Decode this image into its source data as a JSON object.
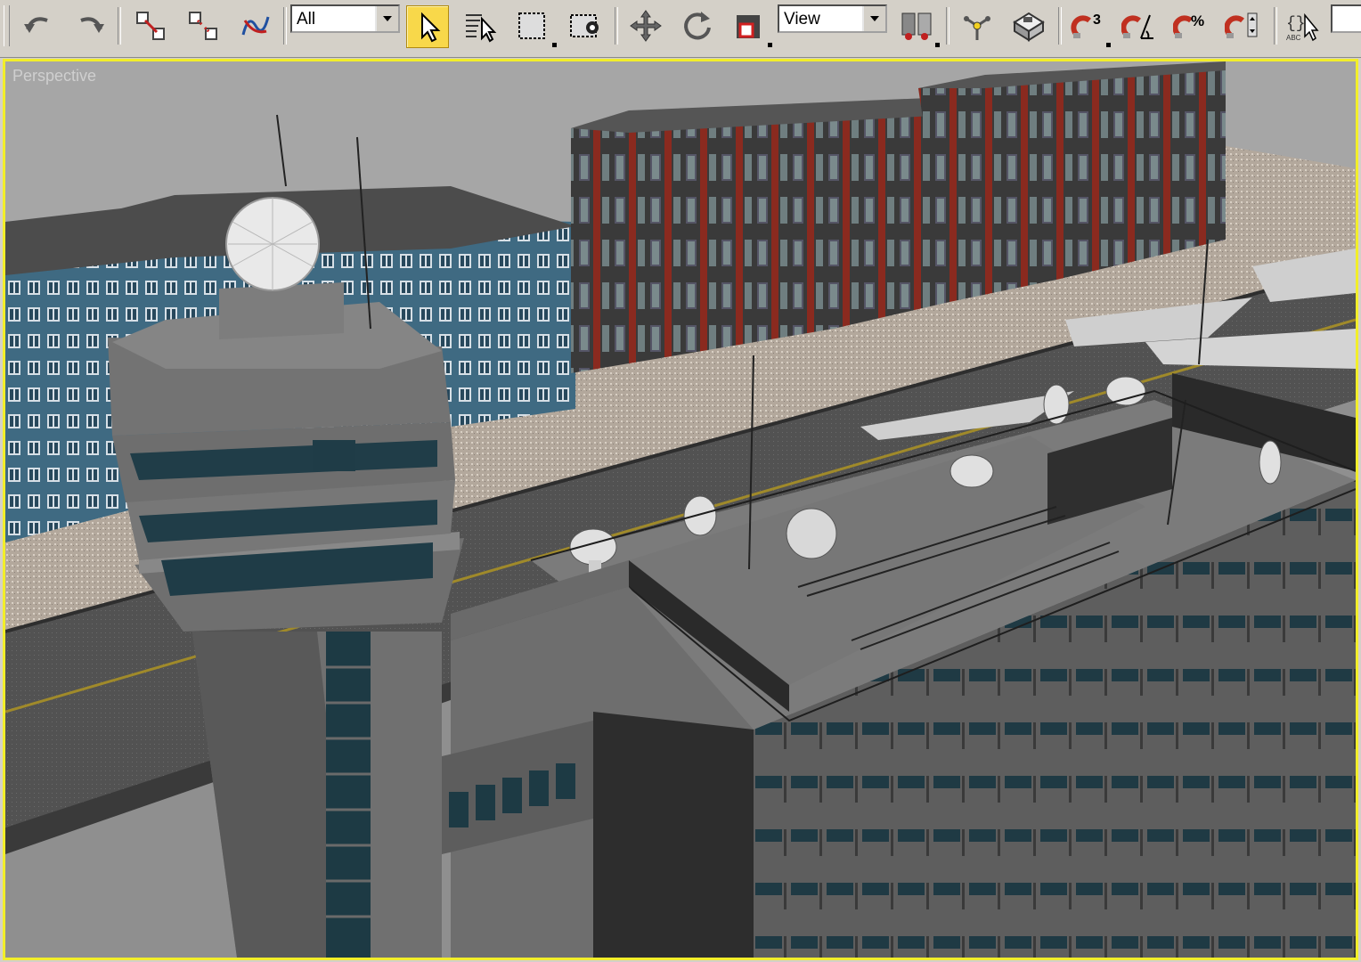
{
  "toolbar": {
    "selection_filter": {
      "value": "All"
    },
    "reference_coord": {
      "value": "View"
    },
    "angle_snap_label": "3",
    "percent_snap_label": "%",
    "named_sets_label": "ABC"
  },
  "viewport": {
    "label": "Perspective",
    "active_border_color": "#f2ee2a"
  },
  "icons": [
    "undo-icon",
    "redo-icon",
    "select-link-icon",
    "unlink-icon",
    "bind-spacewarp-icon",
    "select-object-icon",
    "select-by-name-icon",
    "rectangular-selection-icon",
    "window-crossing-icon",
    "move-icon",
    "rotate-icon",
    "scale-icon",
    "pivot-center-icon",
    "mirror-icon",
    "align-icon",
    "snap-3d-icon",
    "angle-snap-icon",
    "percent-snap-icon",
    "spinner-snap-icon",
    "named-selection-icon"
  ],
  "colors": {
    "toolbar_bg": "#d4d0c8",
    "active_tool": "#f8d84a",
    "viewport_bg": "#a7a7a7"
  }
}
